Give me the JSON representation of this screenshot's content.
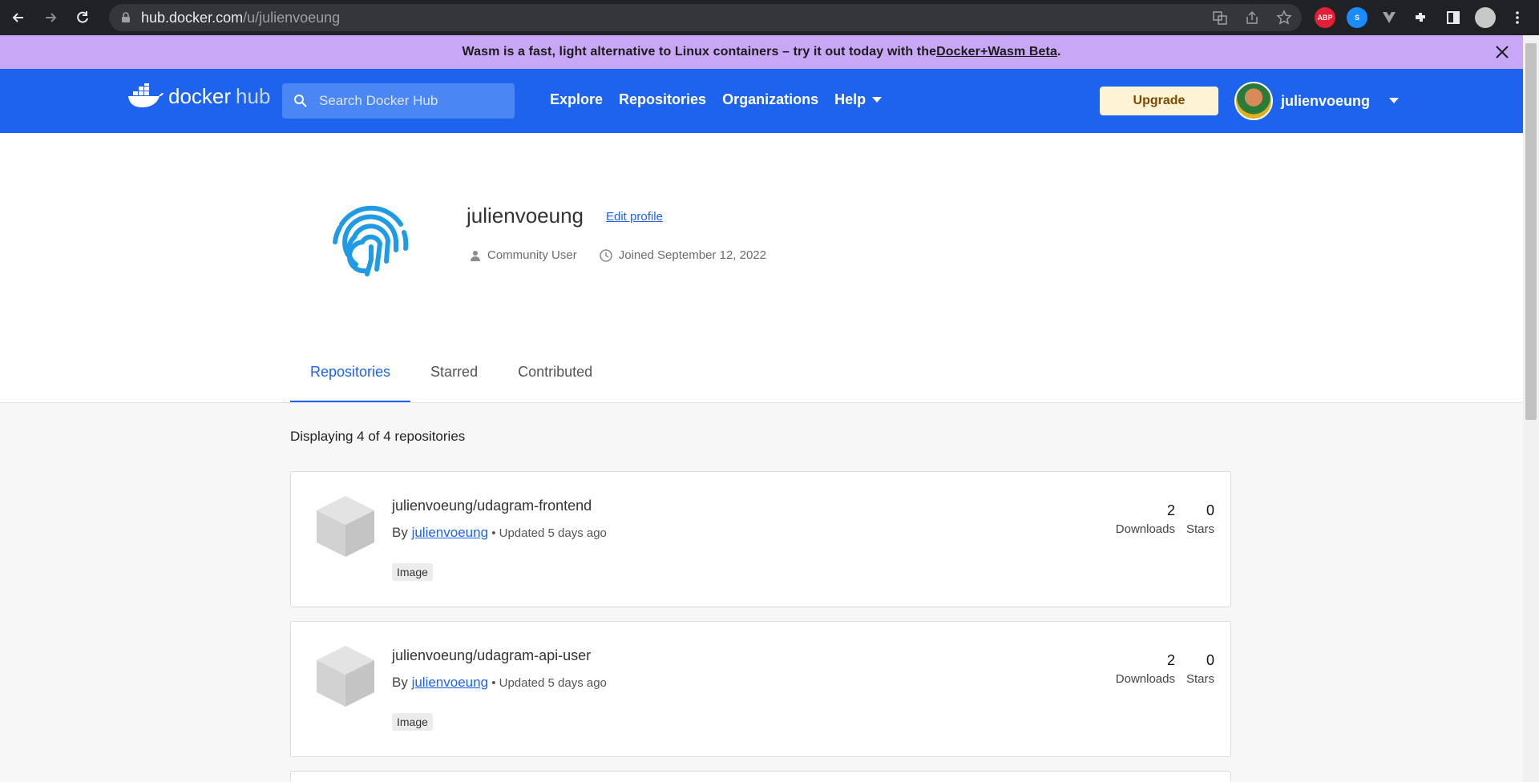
{
  "browser": {
    "url_host": "hub.docker.com",
    "url_path": "/u/julienvoeung",
    "ext_abp": "ABP"
  },
  "banner": {
    "text": "Wasm is a fast, light alternative to Linux containers – try it out today with the ",
    "link": "Docker+Wasm Beta",
    "suffix": "."
  },
  "header": {
    "logo_docker": "docker",
    "logo_hub": "hub",
    "search_placeholder": "Search Docker Hub",
    "menu": [
      "Explore",
      "Repositories",
      "Organizations",
      "Help"
    ],
    "upgrade": "Upgrade",
    "username": "julienvoeung"
  },
  "profile": {
    "username": "julienvoeung",
    "edit_label": "Edit profile",
    "role": "Community User",
    "joined": "Joined September 12, 2022",
    "tabs": [
      "Repositories",
      "Starred",
      "Contributed"
    ]
  },
  "repos": {
    "count_text": "Displaying 4 of 4 repositories",
    "items": [
      {
        "name": "julienvoeung/udagram-frontend",
        "by_prefix": "By ",
        "owner": "julienvoeung",
        "updated": " • Updated 5 days ago",
        "badge": "Image",
        "downloads": "2",
        "downloads_label": "Downloads",
        "stars": "0",
        "stars_label": "Stars"
      },
      {
        "name": "julienvoeung/udagram-api-user",
        "by_prefix": "By ",
        "owner": "julienvoeung",
        "updated": " • Updated 5 days ago",
        "badge": "Image",
        "downloads": "2",
        "downloads_label": "Downloads",
        "stars": "0",
        "stars_label": "Stars"
      }
    ]
  },
  "colors": {
    "docker_blue": "#1d63ed",
    "banner_purple": "#c9a7f7"
  }
}
